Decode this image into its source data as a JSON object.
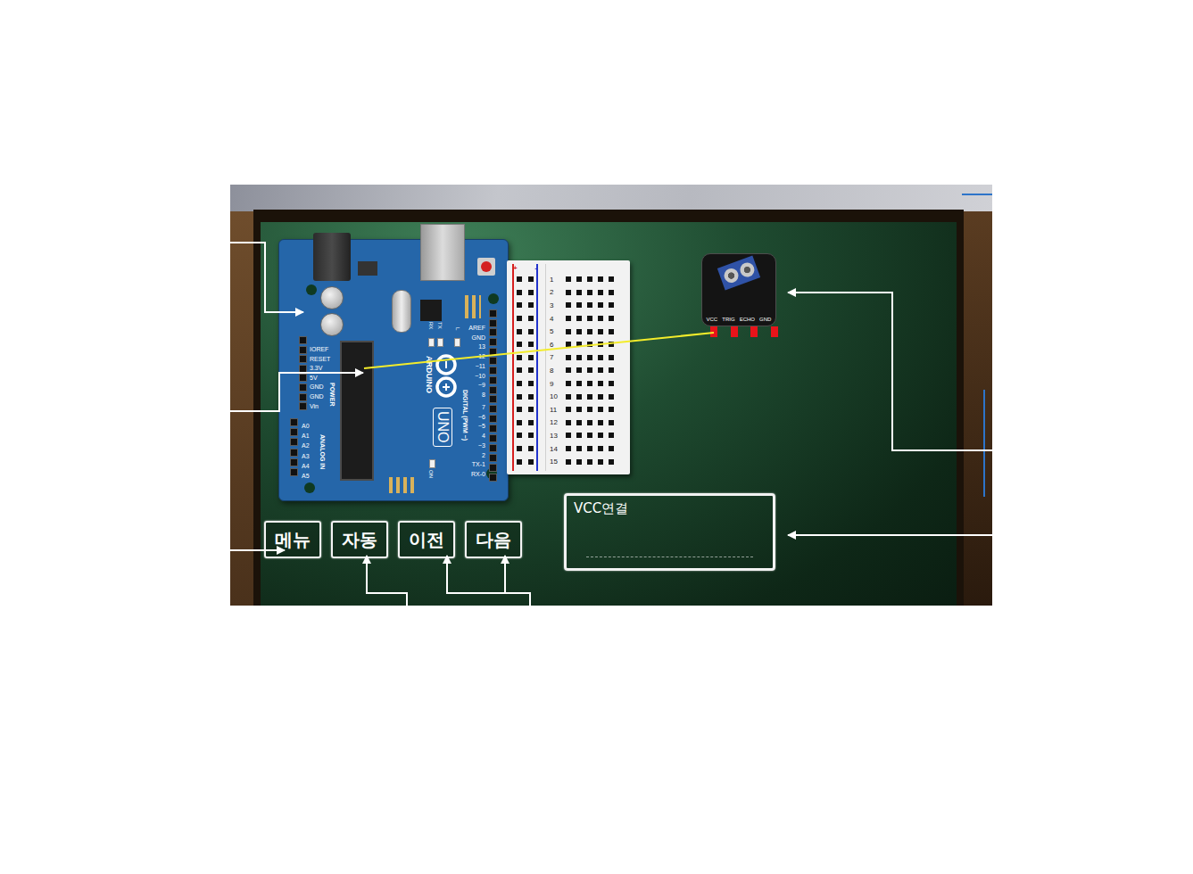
{
  "scene": {
    "arduino": {
      "brand": "ARDUINO",
      "model": "UNO",
      "power_led_label": "ON",
      "tx_led_label": "TX",
      "rx_led_label": "RX",
      "l_led_label": "L",
      "power_header": {
        "title": "POWER",
        "pins": [
          "IOREF",
          "RESET",
          "3.3V",
          "5V",
          "GND",
          "GND",
          "Vin"
        ]
      },
      "analog_header": {
        "title": "ANALOG IN",
        "pins": [
          "A0",
          "A1",
          "A2",
          "A3",
          "A4",
          "A5"
        ]
      },
      "digital_header": {
        "title": "DIGITAL (PWM ~)",
        "pins_upper": [
          "AREF",
          "GND",
          "13",
          "12",
          "~11",
          "~10",
          "~9",
          "8"
        ],
        "pins_lower": [
          "7",
          "~6",
          "~5",
          "4",
          "~3",
          "2",
          "TX-1",
          "RX-0"
        ]
      }
    },
    "breadboard": {
      "rail_plus": "+",
      "rail_minus": "-",
      "row_numbers": [
        "1",
        "2",
        "3",
        "4",
        "5",
        "6",
        "7",
        "8",
        "9",
        "10",
        "11",
        "12",
        "13",
        "14",
        "15"
      ]
    },
    "sensor": {
      "pins": [
        "VCC",
        "TRIG",
        "ECHO",
        "GND"
      ]
    },
    "controls": [
      {
        "label": "메뉴"
      },
      {
        "label": "자동"
      },
      {
        "label": "이전"
      },
      {
        "label": "다음"
      }
    ],
    "message_box": {
      "text": "VCC연결"
    }
  }
}
